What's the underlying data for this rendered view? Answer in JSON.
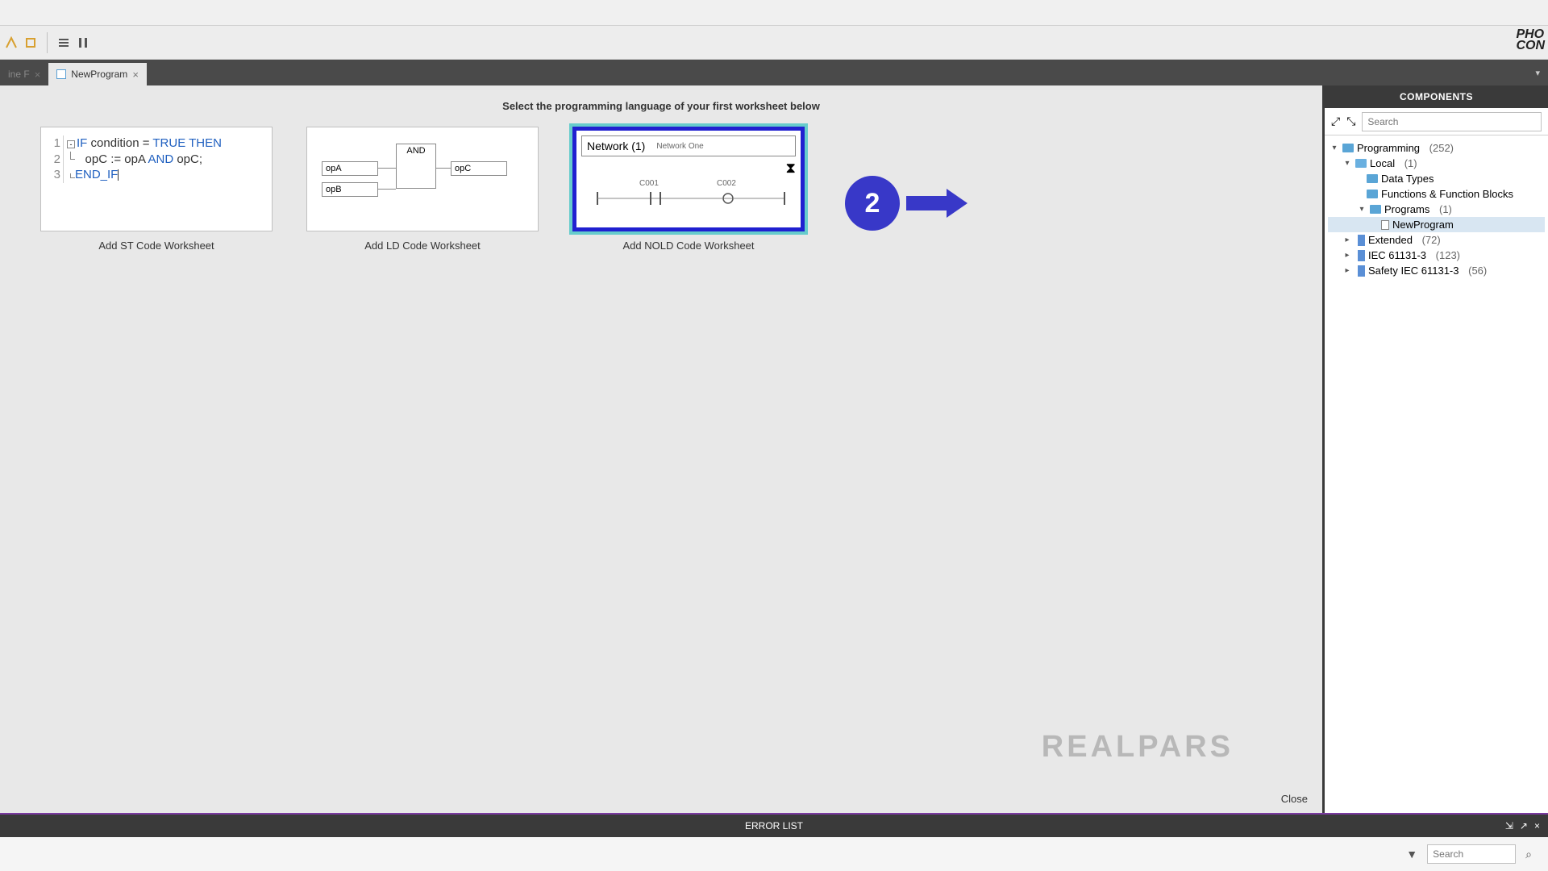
{
  "tabs": {
    "partial": "ine F",
    "active": "NewProgram"
  },
  "prompt": "Select the programming language of your first worksheet below",
  "st": {
    "l1a": "IF",
    "l1b": " condition = ",
    "l1c": "TRUE THEN",
    "l2a": "opC := opA ",
    "l2b": "AND",
    "l2c": " opC;",
    "l3": "END_IF",
    "caption": "Add ST Code Worksheet"
  },
  "ld": {
    "and": "AND",
    "opA": "opA",
    "opB": "opB",
    "opC": "opC",
    "caption": "Add LD Code Worksheet"
  },
  "nold": {
    "net": "Network (1)",
    "netname": "Network One",
    "c1": "C001",
    "c2": "C002",
    "caption": "Add NOLD Code Worksheet"
  },
  "side": {
    "title": "COMPONENTS",
    "search_ph": "Search",
    "programming": "Programming",
    "programming_count": "(252)",
    "local": "Local",
    "local_count": "(1)",
    "datatypes": "Data Types",
    "funcs": "Functions & Function Blocks",
    "programs": "Programs",
    "programs_count": "(1)",
    "newprogram": "NewProgram",
    "extended": "Extended",
    "extended_count": "(72)",
    "iec": "IEC 61131-3",
    "iec_count": "(123)",
    "safety": "Safety IEC 61131-3",
    "safety_count": "(56)"
  },
  "callout": "2",
  "watermark": "REALPARS",
  "close": "Close",
  "errorlist": {
    "title": "ERROR LIST",
    "search_ph": "Search"
  },
  "brand": {
    "l1": "PHO",
    "l2": "CON"
  }
}
